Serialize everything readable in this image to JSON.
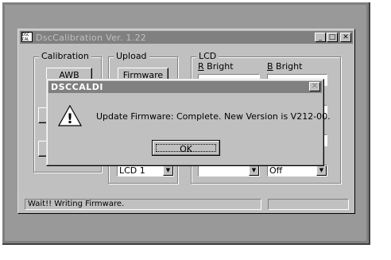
{
  "main_window": {
    "app_icon_text": "DSC CAL",
    "title": "DscCalibration  Ver. 1.22",
    "controls": {
      "minimize": "_",
      "maximize": "□",
      "close": "✕"
    }
  },
  "calibration": {
    "label": "Calibration",
    "awb_button": "AWB"
  },
  "upload": {
    "label": "Upload",
    "firmware_button": "Firmware",
    "lcd_select": "LCD 1"
  },
  "lcd": {
    "label": "LCD",
    "r_bright_label": "R Bright",
    "b_bright_label": "B Bright",
    "r_hotkey": "R",
    "b_hotkey": "B",
    "r_bright_rest": " Bright",
    "b_bright_rest": " Bright",
    "bottom_right_select": "Off"
  },
  "status": {
    "message": "Wait!!  Writing Firmware.",
    "secondary": ""
  },
  "dialog": {
    "title": "DSCCALDI",
    "close": "✕",
    "icon": "warning-icon",
    "icon_glyph": "!",
    "message": "Update Firmware: Complete. New Version is V212-00.",
    "ok_label": "OK"
  }
}
